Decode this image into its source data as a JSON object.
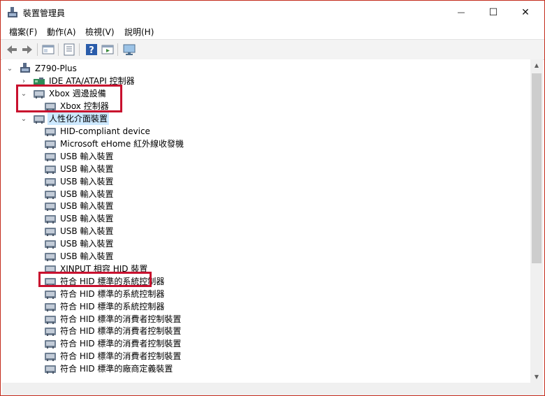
{
  "window": {
    "title": "裝置管理員",
    "minimize_glyph": "—",
    "maximize_glyph": "☐",
    "close_glyph": "✕"
  },
  "menu": [
    "檔案(F)",
    "動作(A)",
    "檢視(V)",
    "說明(H)"
  ],
  "toolbar": {
    "buttons": [
      "back-icon",
      "forward-icon",
      "properties-panel-icon",
      "details-icon",
      "help-icon",
      "run-icon",
      "monitor-icon"
    ]
  },
  "tree": {
    "root": "Z790-Plus",
    "ide": "IDE ATA/ATAPI 控制器",
    "xbox_category": "Xbox 週邊設備",
    "xbox_controller": "Xbox 控制器",
    "hid_category": "人性化介面裝置",
    "hid_items": [
      "HID-compliant device",
      "Microsoft eHome 紅外線收發機",
      "USB 輸入裝置",
      "USB 輸入裝置",
      "USB 輸入裝置",
      "USB 輸入裝置",
      "USB 輸入裝置",
      "USB 輸入裝置",
      "USB 輸入裝置",
      "USB 輸入裝置",
      "USB 輸入裝置",
      "XINPUT 相容 HID 裝置",
      "符合 HID 標準的系統控制器",
      "符合 HID 標準的系統控制器",
      "符合 HID 標準的系統控制器",
      "符合 HID 標準的消費者控制裝置",
      "符合 HID 標準的消費者控制裝置",
      "符合 HID 標準的消費者控制裝置",
      "符合 HID 標準的消費者控制裝置",
      "符合 HID 標準的廠商定義裝置"
    ]
  },
  "colors": {
    "highlight_border": "#c8102e",
    "selection_bg": "#cce8ff",
    "window_border": "#c42b1c"
  }
}
